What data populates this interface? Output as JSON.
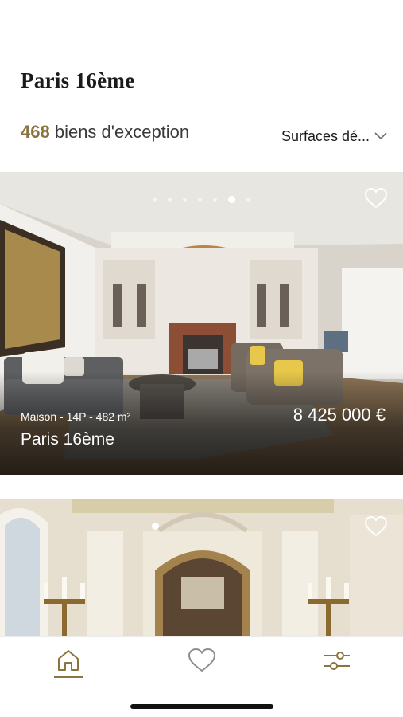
{
  "header": {
    "title": "Paris 16ème",
    "results_count": "468",
    "results_label": " biens d'exception",
    "sort_label": "Surfaces dé..."
  },
  "listings": [
    {
      "meta": "Maison - 14P - 482 m²",
      "price": "8 425 000 €",
      "city": "Paris 16ème",
      "photo_count": 7,
      "active_photo": 6,
      "favorite": false
    },
    {
      "meta": "",
      "price": "",
      "city": "",
      "photo_count": 1,
      "active_photo": 1,
      "favorite": false
    }
  ],
  "tab_bar": {
    "tabs": [
      {
        "icon": "home-icon",
        "active": true
      },
      {
        "icon": "heart-icon",
        "active": false
      },
      {
        "icon": "filters-icon",
        "active": false
      }
    ]
  },
  "colors": {
    "accent": "#8b7440",
    "text": "#1b1b1b"
  }
}
